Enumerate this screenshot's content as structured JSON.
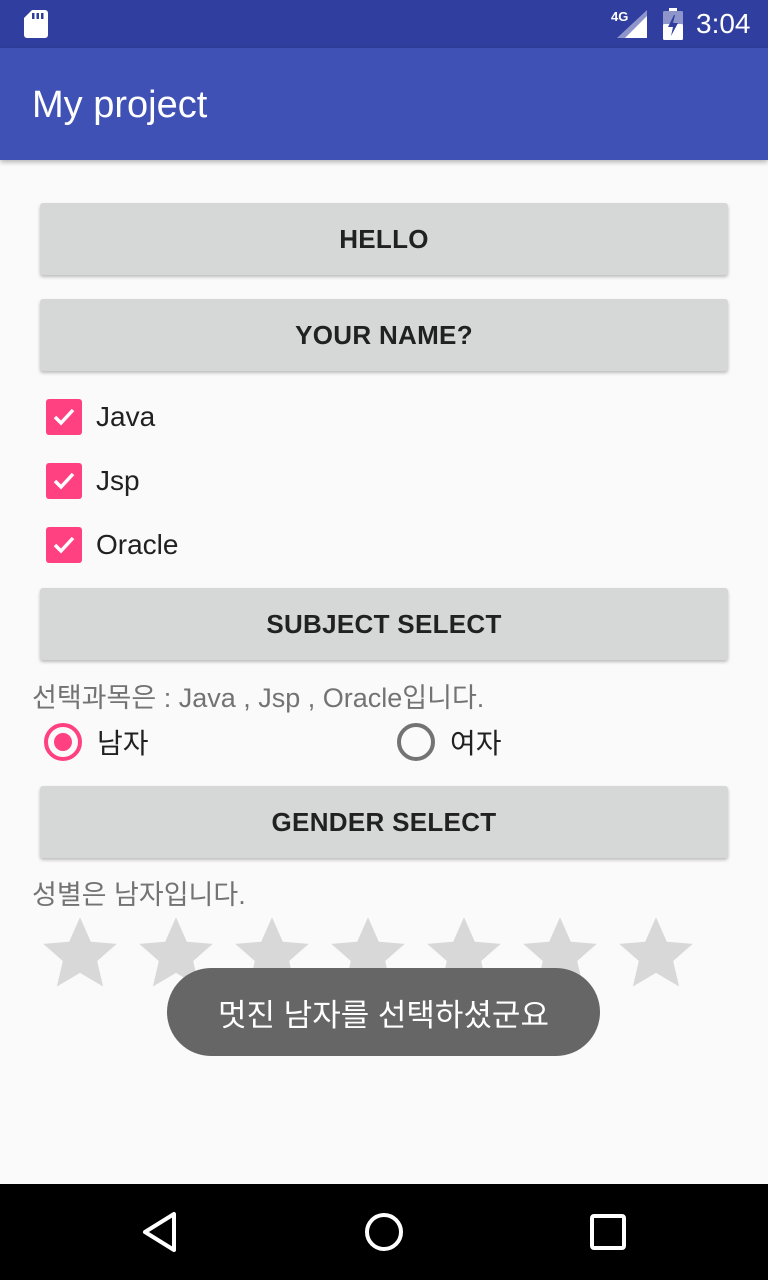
{
  "status_bar": {
    "network": "4G",
    "time": "3:04",
    "icons": [
      "sd-card-icon",
      "cell-signal-icon",
      "battery-charging-icon"
    ]
  },
  "app_bar": {
    "title": "My project"
  },
  "buttons": {
    "hello": "HELLO",
    "your_name": "YOUR NAME?",
    "subject_select": "SUBJECT SELECT",
    "gender_select": "GENDER SELECT"
  },
  "checkboxes": [
    {
      "label": "Java",
      "checked": true
    },
    {
      "label": "Jsp",
      "checked": true
    },
    {
      "label": "Oracle",
      "checked": true
    }
  ],
  "subject_result": "선택과목은 :  Java , Jsp , Oracle입니다.",
  "radios": [
    {
      "label": "남자",
      "selected": true
    },
    {
      "label": "여자",
      "selected": false
    }
  ],
  "gender_result": "성별은  남자입니다.",
  "rating": {
    "stars": 7,
    "value": 0
  },
  "toast": "멋진 남자를 선택하셨군요",
  "colors": {
    "status_bar": "#303f9f",
    "app_bar": "#3f51b5",
    "accent": "#ff4081",
    "button": "#d6d7d7",
    "star_empty": "#d8d8d8",
    "toast_bg": "#666666"
  }
}
